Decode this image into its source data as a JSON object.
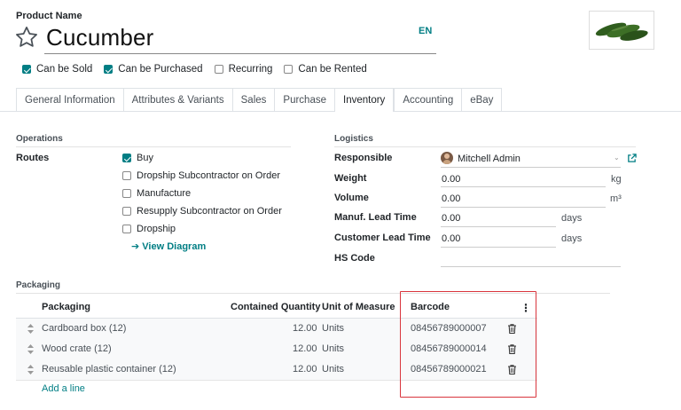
{
  "product": {
    "name_label": "Product Name",
    "name": "Cucumber",
    "lang": "EN",
    "image_icon": "cucumber-photo"
  },
  "flags": [
    {
      "label": "Can be Sold",
      "checked": true
    },
    {
      "label": "Can be Purchased",
      "checked": true
    },
    {
      "label": "Recurring",
      "checked": false
    },
    {
      "label": "Can be Rented",
      "checked": false
    }
  ],
  "tabs": [
    "General Information",
    "Attributes & Variants",
    "Sales",
    "Purchase",
    "Inventory",
    "Accounting",
    "eBay"
  ],
  "active_tab": "Inventory",
  "operations": {
    "title": "Operations",
    "routes_label": "Routes",
    "routes": [
      {
        "label": "Buy",
        "checked": true
      },
      {
        "label": "Dropship Subcontractor on Order",
        "checked": false
      },
      {
        "label": "Manufacture",
        "checked": false
      },
      {
        "label": "Resupply Subcontractor on Order",
        "checked": false
      },
      {
        "label": "Dropship",
        "checked": false
      }
    ],
    "view_diagram": "View Diagram"
  },
  "logistics": {
    "title": "Logistics",
    "responsible_label": "Responsible",
    "responsible_value": "Mitchell Admin",
    "weight_label": "Weight",
    "weight_value": "0.00",
    "weight_unit": "kg",
    "volume_label": "Volume",
    "volume_value": "0.00",
    "volume_unit": "m³",
    "manuf_label": "Manuf. Lead Time",
    "manuf_value": "0.00",
    "manuf_unit": "days",
    "customer_label": "Customer Lead Time",
    "customer_value": "0.00",
    "customer_unit": "days",
    "hs_label": "HS Code",
    "hs_value": ""
  },
  "packaging": {
    "title": "Packaging",
    "columns": [
      "Packaging",
      "Contained Quantity",
      "Unit of Measure",
      "Barcode"
    ],
    "rows": [
      {
        "name": "Cardboard box (12)",
        "qty": "12.00",
        "uom": "Units",
        "barcode": "08456789000007"
      },
      {
        "name": "Wood crate (12)",
        "qty": "12.00",
        "uom": "Units",
        "barcode": "08456789000014"
      },
      {
        "name": "Reusable plastic container (12)",
        "qty": "12.00",
        "uom": "Units",
        "barcode": "08456789000021"
      }
    ],
    "add_line": "Add a line"
  },
  "colors": {
    "accent": "#017e84",
    "highlight": "#d9363e"
  }
}
